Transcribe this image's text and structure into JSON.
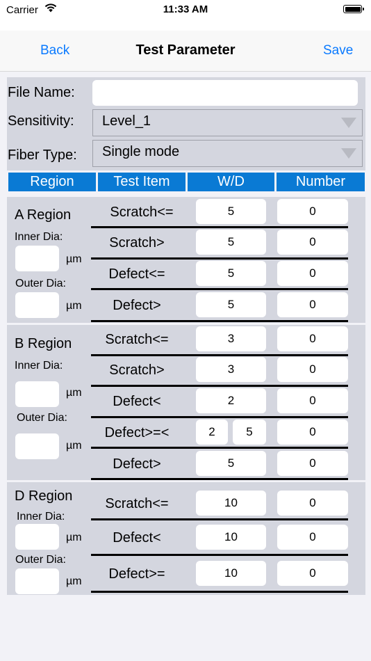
{
  "status_bar": {
    "carrier": "Carrier",
    "time": "11:33 AM"
  },
  "nav": {
    "back_label": "Back",
    "title": "Test Parameter",
    "save_label": "Save"
  },
  "form": {
    "file_name_label": "File Name:",
    "file_name_value": "",
    "sensitivity_label": "Sensitivity:",
    "sensitivity_value": "Level_1",
    "fiber_type_label": "Fiber Type:",
    "fiber_type_value": "Single mode"
  },
  "table_headers": [
    "Region",
    "Test Item",
    "W/D",
    "Number"
  ],
  "regions": [
    {
      "name": "A Region",
      "inner_label": "Inner Dia:",
      "outer_label": "Outer Dia:",
      "unit": "µm",
      "inner_value": "",
      "outer_value": "",
      "rows": [
        {
          "item": "Scratch<=",
          "wd": [
            "5"
          ],
          "number": "0"
        },
        {
          "item": "Scratch>",
          "wd": [
            "5"
          ],
          "number": "0"
        },
        {
          "item": "Defect<=",
          "wd": [
            "5"
          ],
          "number": "0"
        },
        {
          "item": "Defect>",
          "wd": [
            "5"
          ],
          "number": "0"
        }
      ]
    },
    {
      "name": "B Region",
      "inner_label": "Inner Dia:",
      "outer_label": "Outer Dia:",
      "unit": "µm",
      "inner_value": "",
      "outer_value": "",
      "rows": [
        {
          "item": "Scratch<=",
          "wd": [
            "3"
          ],
          "number": "0"
        },
        {
          "item": "Scratch>",
          "wd": [
            "3"
          ],
          "number": "0"
        },
        {
          "item": "Defect<",
          "wd": [
            "2"
          ],
          "number": "0"
        },
        {
          "item": "Defect>=<",
          "wd": [
            "2",
            "5"
          ],
          "number": "0"
        },
        {
          "item": "Defect>",
          "wd": [
            "5"
          ],
          "number": "0"
        }
      ]
    },
    {
      "name": "D Region",
      "inner_label": "Inner Dia:",
      "outer_label": "Outer Dia:",
      "unit": "µm",
      "inner_value": "",
      "outer_value": "",
      "rows": [
        {
          "item": "Scratch<=",
          "wd": [
            "10"
          ],
          "number": "0"
        },
        {
          "item": "Defect<",
          "wd": [
            "10"
          ],
          "number": "0"
        },
        {
          "item": "Defect>=",
          "wd": [
            "10"
          ],
          "number": "0"
        }
      ]
    }
  ]
}
